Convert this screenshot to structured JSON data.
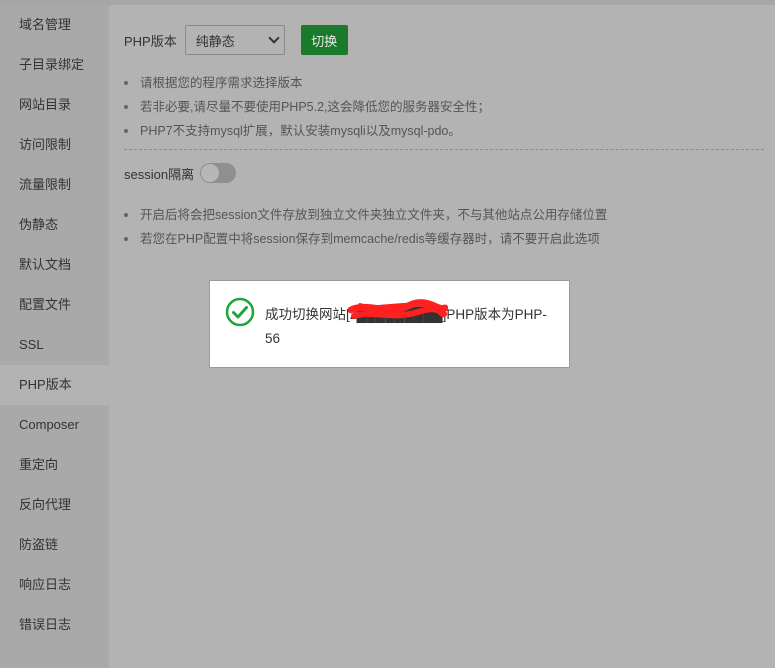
{
  "sidebar": {
    "items": [
      {
        "label": "域名管理"
      },
      {
        "label": "子目录绑定"
      },
      {
        "label": "网站目录"
      },
      {
        "label": "访问限制"
      },
      {
        "label": "流量限制"
      },
      {
        "label": "伪静态"
      },
      {
        "label": "默认文档"
      },
      {
        "label": "配置文件"
      },
      {
        "label": "SSL"
      },
      {
        "label": "PHP版本",
        "active": true
      },
      {
        "label": "Composer"
      },
      {
        "label": "重定向"
      },
      {
        "label": "反向代理"
      },
      {
        "label": "防盗链"
      },
      {
        "label": "响应日志"
      },
      {
        "label": "错误日志"
      }
    ]
  },
  "php": {
    "label": "PHP版本",
    "selected": "纯静态",
    "switch_label": "切换",
    "tips": [
      "请根据您的程序需求选择版本",
      "若非必要,请尽量不要使用PHP5.2,这会降低您的服务器安全性；",
      "PHP7不支持mysql扩展，默认安装mysqli以及mysql-pdo。"
    ]
  },
  "session": {
    "label": "session隔离",
    "enabled": false,
    "tips": [
      "开启后将会把session文件存放到独立文件夹独立文件夹，不与其他站点公用存储位置",
      "若您在PHP配置中将session保存到memcache/redis等缓存器时，请不要开启此选项"
    ]
  },
  "toast": {
    "message": "成功切换网站[z█████████]PHP版本为PHP-56",
    "icon": "check-circle-icon",
    "icon_color": "#20a53a",
    "redaction_color": "#ff2020"
  },
  "colors": {
    "accent": "#1a7a2c",
    "overlay": "#b3b3b3"
  }
}
